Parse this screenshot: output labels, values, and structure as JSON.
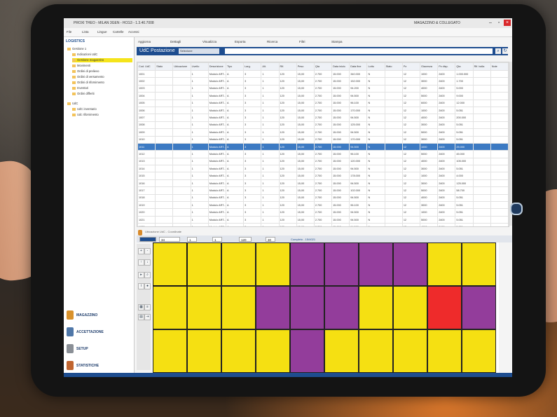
{
  "window": {
    "title": "PROXI THEO - MILAN 3GEN - HCG3 - 1.3.40.7008",
    "user": "MAGAZZINO & COLLEGATO"
  },
  "menu": [
    "File",
    "Lista",
    "Lingue",
    "Cartelle",
    "Accessi"
  ],
  "sidebar": {
    "title": "LOGISTICS",
    "tree": [
      "Gestione 1",
      "Indicazioni UdC",
      "Gestione magazzino",
      "Movimenti",
      "Ordini di prelievo",
      "Ordini di versamento",
      "Ordini di rifornimento",
      "Inventari",
      "Ordini differiti",
      "UdC",
      "UdC inventario",
      "Udc rifornimento"
    ],
    "nav": [
      {
        "label": "MAGAZZINO",
        "color": "#d9922c"
      },
      {
        "label": "ACCETTAZIONE",
        "color": "#4f77a8"
      },
      {
        "label": "SETUP",
        "color": "#8a8f96"
      },
      {
        "label": "STATISTICHE",
        "color": "#c06530"
      }
    ]
  },
  "toolbar": [
    "Aggiorna",
    "Dettagli",
    "Visualizza",
    "Esporta",
    "Ricerca",
    "Filtri",
    "Stampa"
  ],
  "module": {
    "title": "UdC Postazione",
    "dropdown": "Selezione"
  },
  "grid": {
    "columns": [
      "Cod. UdC",
      "Stato",
      "Ubicazione",
      "Livello",
      "Descrizione",
      "Tipo",
      "Larg.",
      "Alt.",
      "Rif.",
      "Peso",
      "Qta",
      "Data inizio",
      "Data fine",
      "Lotto",
      "Stato",
      "Pz",
      "Giacenza",
      "Pz disp.",
      "Qta",
      "Rif. bolla",
      "Note"
    ],
    "rows": [
      [
        "1001",
        "",
        "",
        "1",
        "Modulo ART...",
        "A",
        "3",
        "1",
        "120",
        "15,00",
        "2.700",
        "15.000",
        "340.000",
        "N",
        "",
        "12",
        "1000",
        "2400",
        "1.000.000"
      ],
      [
        "1002",
        "",
        "",
        "1",
        "Modulo ART...",
        "A",
        "3",
        "1",
        "120",
        "15,00",
        "2.700",
        "15.000",
        "152.000",
        "N",
        "",
        "12",
        "3000",
        "2400",
        "1.700"
      ],
      [
        "1003",
        "",
        "",
        "1",
        "Modulo ART...",
        "A",
        "3",
        "1",
        "120",
        "15,00",
        "2.700",
        "15.000",
        "94.200",
        "N",
        "",
        "12",
        "4000",
        "2400",
        "5.000"
      ],
      [
        "1004",
        "",
        "",
        "1",
        "Modulo ART...",
        "A",
        "3",
        "1",
        "120",
        "15,00",
        "2.700",
        "15.000",
        "94.500",
        "N",
        "",
        "12",
        "5000",
        "2400",
        "9.000"
      ],
      [
        "1005",
        "",
        "",
        "1",
        "Modulo ART...",
        "A",
        "3",
        "1",
        "120",
        "15,00",
        "2.700",
        "15.000",
        "96.100",
        "N",
        "",
        "12",
        "6000",
        "2400",
        "12.000"
      ],
      [
        "1006",
        "",
        "",
        "1",
        "Modulo ART...",
        "A",
        "3",
        "1",
        "120",
        "15,00",
        "2.700",
        "15.000",
        "170.000",
        "N",
        "",
        "12",
        "1000",
        "2400",
        "5.051"
      ],
      [
        "1007",
        "",
        "",
        "1",
        "Modulo ART...",
        "A",
        "3",
        "1",
        "120",
        "15,00",
        "2.700",
        "15.000",
        "94.500",
        "N",
        "",
        "12",
        "4000",
        "2400",
        "200.000"
      ],
      [
        "1008",
        "",
        "",
        "1",
        "Modulo ART...",
        "A",
        "3",
        "1",
        "120",
        "15,00",
        "2.700",
        "15.000",
        "125.000",
        "N",
        "",
        "12",
        "3000",
        "2400",
        "5.051"
      ],
      [
        "1009",
        "",
        "",
        "1",
        "Modulo ART...",
        "A",
        "3",
        "1",
        "120",
        "15,00",
        "2.700",
        "15.000",
        "94.500",
        "N",
        "",
        "12",
        "5000",
        "2400",
        "5.051"
      ],
      [
        "1010",
        "",
        "",
        "1",
        "Modulo ART...",
        "A",
        "3",
        "1",
        "120",
        "15,00",
        "2.700",
        "15.000",
        "170.000",
        "N",
        "",
        "12",
        "3000",
        "2400",
        "5.051"
      ],
      [
        "1011",
        "",
        "",
        "1",
        "Modulo ART...",
        "A",
        "3",
        "1",
        "120",
        "15,00",
        "2.700",
        "15.000",
        "94.500",
        "N",
        "",
        "12",
        "1000",
        "2400",
        "25.000"
      ],
      [
        "1012",
        "",
        "",
        "1",
        "Modulo ART...",
        "A",
        "3",
        "1",
        "120",
        "15,00",
        "2.700",
        "15.000",
        "96.100",
        "N",
        "",
        "12",
        "5000",
        "2400",
        "45.000"
      ],
      [
        "1013",
        "",
        "",
        "1",
        "Modulo ART...",
        "A",
        "3",
        "1",
        "120",
        "15,00",
        "2.700",
        "15.000",
        "120.000",
        "N",
        "",
        "12",
        "4000",
        "2400",
        "105.000"
      ],
      [
        "1014",
        "",
        "",
        "1",
        "Modulo ART...",
        "A",
        "3",
        "1",
        "120",
        "15,00",
        "2.700",
        "15.000",
        "94.500",
        "N",
        "",
        "12",
        "3000",
        "2400",
        "5.051"
      ],
      [
        "1015",
        "",
        "",
        "1",
        "Modulo ART...",
        "A",
        "3",
        "1",
        "120",
        "15,00",
        "2.700",
        "15.000",
        "178.000",
        "N",
        "",
        "12",
        "1000",
        "2400",
        "4.000"
      ],
      [
        "1016",
        "",
        "",
        "1",
        "Modulo ART...",
        "A",
        "3",
        "1",
        "120",
        "15,00",
        "2.700",
        "15.000",
        "94.500",
        "N",
        "",
        "12",
        "3000",
        "2400",
        "125.000"
      ],
      [
        "1017",
        "",
        "",
        "1",
        "Modulo ART...",
        "A",
        "3",
        "1",
        "120",
        "15,00",
        "2.700",
        "15.000",
        "102.000",
        "N",
        "",
        "12",
        "5000",
        "2400",
        "58.700"
      ],
      [
        "1018",
        "",
        "",
        "1",
        "Modulo ART...",
        "A",
        "3",
        "1",
        "120",
        "15,00",
        "2.700",
        "15.000",
        "94.500",
        "N",
        "",
        "12",
        "4000",
        "2400",
        "5.051"
      ],
      [
        "1019",
        "",
        "",
        "1",
        "Modulo ART...",
        "A",
        "3",
        "1",
        "120",
        "15,00",
        "2.700",
        "15.000",
        "96.100",
        "N",
        "",
        "12",
        "3000",
        "2400",
        "5.051"
      ],
      [
        "1020",
        "",
        "",
        "1",
        "Modulo ART...",
        "A",
        "3",
        "1",
        "120",
        "15,00",
        "2.700",
        "15.000",
        "94.500",
        "N",
        "",
        "12",
        "1000",
        "2400",
        "5.051"
      ],
      [
        "1021",
        "",
        "",
        "1",
        "Modulo ART...",
        "A",
        "3",
        "1",
        "120",
        "15,00",
        "2.700",
        "15.000",
        "94.500",
        "N",
        "",
        "12",
        "5000",
        "2400",
        "5.051"
      ],
      [
        "1022",
        "",
        "",
        "1",
        "Modulo ART...",
        "A",
        "3",
        "1",
        "120",
        "15,00",
        "2.700",
        "15.000",
        "94.500",
        "N",
        "",
        "12",
        "4000",
        "2400",
        "5.051"
      ],
      [
        "1023",
        "",
        "",
        "1",
        "Modulo ART...",
        "A",
        "3",
        "1",
        "120",
        "15,00",
        "2.700",
        "15.000",
        "94.500",
        "N",
        "",
        "12",
        "3000",
        "2400",
        "5.051"
      ]
    ],
    "selected_row": 10
  },
  "lower": {
    "info": "Ubicazione UdC - Coordinate",
    "field_a": "34",
    "field_b": "1",
    "field_c": "1",
    "field_d": "120",
    "field_e": "30",
    "status_text": "Completo - 15/4021"
  },
  "cells": {
    "rows": [
      [
        "#f5e012",
        "#f5e012",
        "#f5e012",
        "#f5e012",
        "#933d9b",
        "#933d9b",
        "#933d9b",
        "#933d9b",
        "#f5e012",
        "#f5e012"
      ],
      [
        "#f5e012",
        "#f5e012",
        "#f5e012",
        "#933d9b",
        "#933d9b",
        "#933d9b",
        "#f5e012",
        "#f5e012",
        "#ee2b2b",
        "#933d9b"
      ],
      [
        "#f5e012",
        "#f5e012",
        "#f5e012",
        "#f5e012",
        "#933d9b",
        "#f5e012",
        "#f5e012",
        "#f5e012",
        "#f5e012",
        "#f5e012"
      ]
    ],
    "selected": [
      0,
      0
    ]
  },
  "colors": {
    "accent": "#1e4d8f",
    "yellow": "#f5e012",
    "purple": "#933d9b",
    "red": "#ee2b2b"
  }
}
